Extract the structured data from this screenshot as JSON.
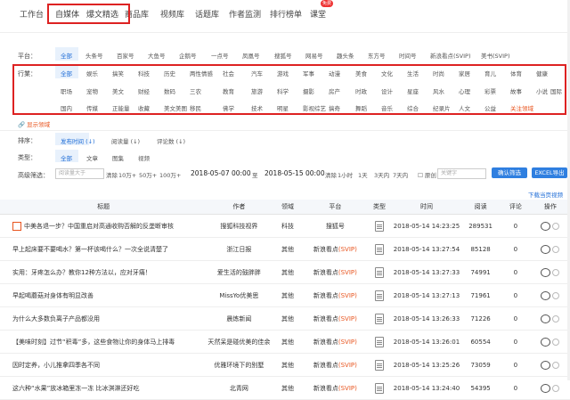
{
  "nav": {
    "tabs": [
      "工作台",
      "自媒体",
      "爆文精选",
      "商品库",
      "视频库",
      "话题库",
      "作者监测",
      "排行榜单",
      "课堂"
    ],
    "badge": "免费"
  },
  "platform": {
    "label": "平台：",
    "items": [
      "全部",
      "头条号",
      "百家号",
      "大鱼号",
      "企鹅号",
      "一点号",
      "凤凰号",
      "搜狐号",
      "网易号",
      "趣头条",
      "东方号",
      "时间号",
      "新浪看点(SVIP)",
      "美书(SVIP)"
    ]
  },
  "category": {
    "label": "行業：",
    "rows": [
      [
        "全部",
        "娱乐",
        "搞笑",
        "科技",
        "历史",
        "两性情感",
        "社会",
        "汽车",
        "游戏",
        "军事",
        "动漫",
        "美食",
        "文化",
        "生活",
        "时尚",
        "家居",
        "育儿",
        "体育",
        "健康"
      ],
      [
        "职场",
        "宠物",
        "美文",
        "财经",
        "数码",
        "三农",
        "教育",
        "旅游",
        "科学",
        "摄影",
        "房产",
        "时政",
        "设计",
        "星座",
        "风水",
        "心理",
        "彩票",
        "故事",
        "小说",
        "国际"
      ],
      [
        "国内",
        "传媒",
        "正能量",
        "收藏",
        "美文美图",
        "移民",
        "佛学",
        "技术",
        "明星",
        "影视综艺",
        "搞奇",
        "舞蹈",
        "音乐",
        "综合",
        "纪录片",
        "人文",
        "公益",
        "关注领域"
      ]
    ],
    "show_more": "显示领域"
  },
  "sort": {
    "label": "排序：",
    "items": [
      "发布时间 (↓)",
      "阅读量 (↓)",
      "评论数 (↓)"
    ]
  },
  "type": {
    "label": "类型：",
    "items": [
      "全部",
      "文章",
      "图集",
      "视频"
    ]
  },
  "filter": {
    "label": "高级筛选：",
    "read_placeholder": "阅读量大于",
    "clear": "清除",
    "read_opts": [
      "10万+",
      "50万+",
      "100万+"
    ],
    "date_from": "2018-05-07 00:00",
    "to": "至",
    "date_to": "2018-05-15 00:00",
    "clear2": "清除",
    "time_opts": [
      "1小时",
      "1天",
      "3天内",
      "7天内"
    ],
    "original": "原创",
    "keyword_placeholder": "关键字",
    "confirm": "确认筛选",
    "export": "EXCEL导出"
  },
  "download_link": "下载当页视频",
  "table": {
    "headers": [
      "标题",
      "作者",
      "领域",
      "平台",
      "类型",
      "时间",
      "阅读",
      "评论",
      "操作"
    ],
    "rows": [
      {
        "title": "中美各退一步？中国重启对高通收购否解的反垄断审核",
        "author": "搜狐科技视界",
        "field": "科技",
        "platform": "搜狐号",
        "vip": "",
        "time": "2018-05-14 14:23:25",
        "read": "289531",
        "comment": "0"
      },
      {
        "title": "早上起床要不要喝水？第一杯该喝什么？一次全说清楚了",
        "author": "浙江日报",
        "field": "其他",
        "platform": "新浪看点",
        "vip": "(SVIP)",
        "time": "2018-05-14 13:27:54",
        "read": "85128",
        "comment": "0"
      },
      {
        "title": "实用：牙疼怎么办？教你12种方法以，应对牙痛！",
        "author": "爱生活的鼓胖胖",
        "field": "其他",
        "platform": "新浪看点",
        "vip": "(SVIP)",
        "time": "2018-05-14 13:27:33",
        "read": "74991",
        "comment": "0"
      },
      {
        "title": "早起喝蘑菇对身体有明显改善",
        "author": "MissYo优美思",
        "field": "其他",
        "platform": "新浪看点",
        "vip": "(SVIP)",
        "time": "2018-05-14 13:27:13",
        "read": "71961",
        "comment": "0"
      },
      {
        "title": "为什么大多数负离子产品都没用",
        "author": "晨炼新闻",
        "field": "其他",
        "platform": "新浪看点",
        "vip": "(SVIP)",
        "time": "2018-05-14 13:26:33",
        "read": "71226",
        "comment": "0"
      },
      {
        "title": "【美味时刻】过节“积毒”多，这些食物让你的身体马上排毒",
        "author": "天然呆是碰优美的佳余",
        "field": "其他",
        "platform": "新浪看点",
        "vip": "(SVIP)",
        "time": "2018-05-14 13:26:01",
        "read": "60554",
        "comment": "0"
      },
      {
        "title": "因时定养，小儿推拿四季各不同",
        "author": "优雅环境下的别墅",
        "field": "其他",
        "platform": "新浪看点",
        "vip": "(SVIP)",
        "time": "2018-05-14 13:25:26",
        "read": "73059",
        "comment": "0"
      },
      {
        "title": "这六种“水果”放冰箱里冻一冻 比冰淇淋还好吃",
        "author": "北青网",
        "field": "其他",
        "platform": "新浪看点",
        "vip": "(SVIP)",
        "time": "2018-05-14 13:24:40",
        "read": "54395",
        "comment": "0"
      }
    ]
  }
}
